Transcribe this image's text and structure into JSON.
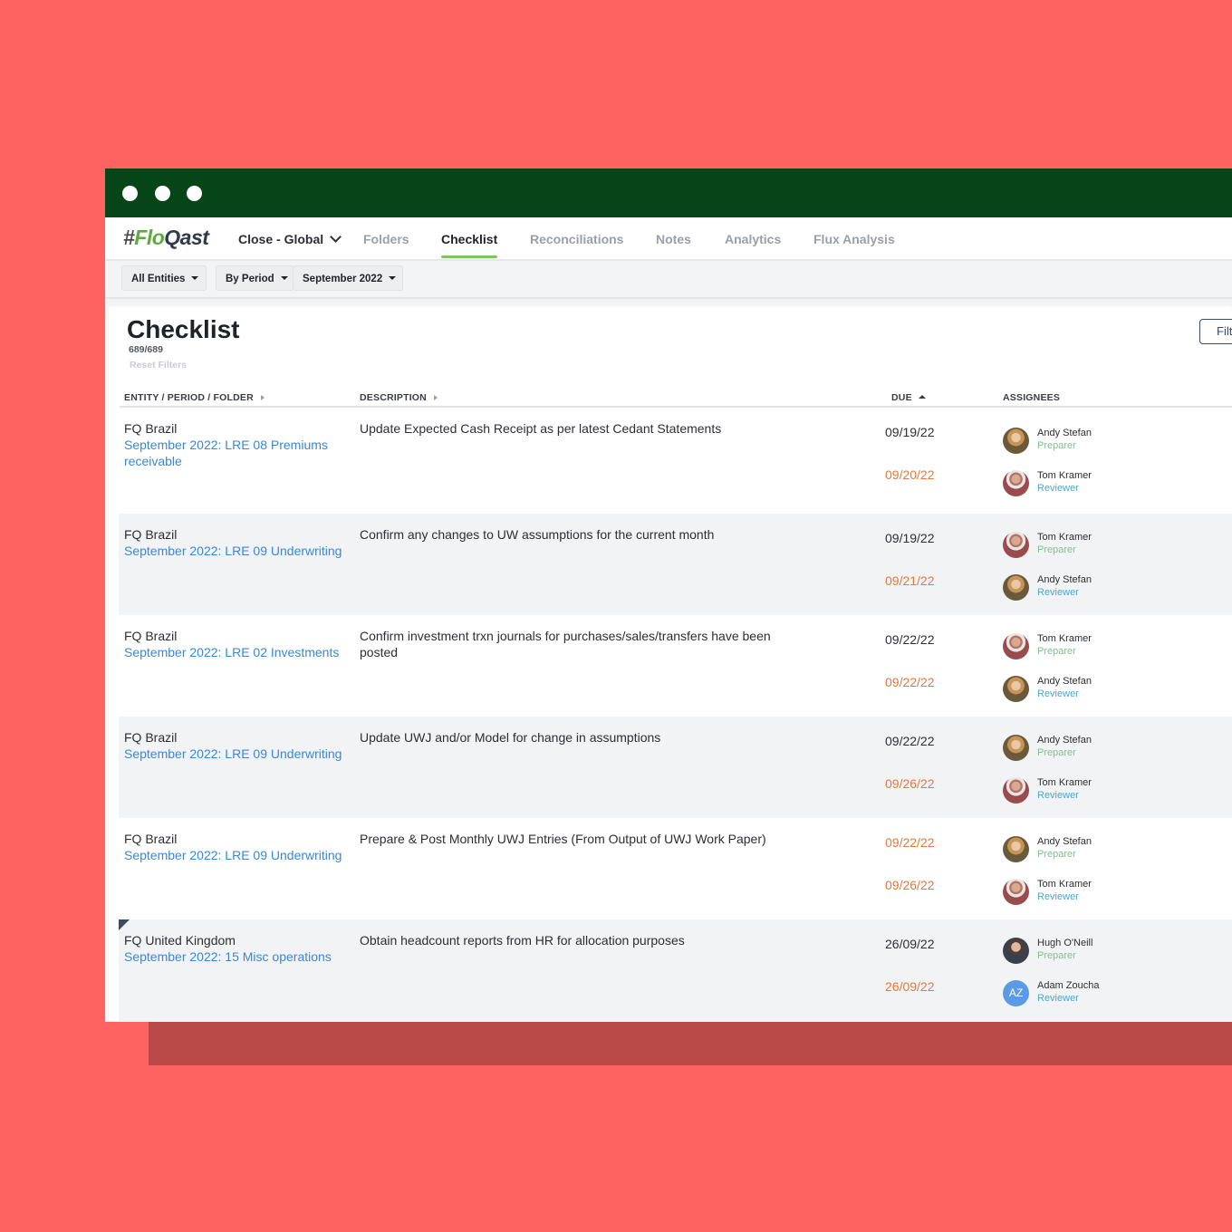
{
  "nav": {
    "logo_hash": "#",
    "logo_flo": "Flo",
    "logo_qast": "Qast",
    "workspace": "Close - Global",
    "tabs": [
      "Folders",
      "Checklist",
      "Reconciliations",
      "Notes",
      "Analytics",
      "Flux Analysis"
    ]
  },
  "filters": {
    "entities": "All Entities",
    "period_mode": "By Period",
    "period": "September 2022"
  },
  "page": {
    "title": "Checklist",
    "count": "689/689",
    "reset": "Reset Filters",
    "filter_btn": "Filt"
  },
  "table": {
    "headers": {
      "entity": "ENTITY / PERIOD / FOLDER",
      "description": "DESCRIPTION",
      "due": "DUE",
      "assignees": "ASSIGNEES"
    },
    "rows": [
      {
        "entity": "FQ Brazil",
        "folder": "September 2022: LRE 08 Premiums receivable",
        "description": "Update Expected Cash Receipt as per latest Cedant Statements",
        "due1": "09/19/22",
        "due2": "09/20/22",
        "a1": {
          "name": "Andy Stefan",
          "role": "Preparer"
        },
        "a2": {
          "name": "Tom Kramer",
          "role": "Reviewer"
        }
      },
      {
        "entity": "FQ Brazil",
        "folder": "September 2022: LRE 09 Underwriting",
        "description": "Confirm any changes to UW assumptions for the current month",
        "due1": "09/19/22",
        "due2": "09/21/22",
        "a1": {
          "name": "Tom Kramer",
          "role": "Preparer"
        },
        "a2": {
          "name": "Andy Stefan",
          "role": "Reviewer"
        }
      },
      {
        "entity": "FQ Brazil",
        "folder": "September 2022: LRE 02 Investments",
        "description": "Confirm investment trxn journals for purchases/sales/transfers have been posted",
        "due1": "09/22/22",
        "due2": "09/22/22",
        "a1": {
          "name": "Tom Kramer",
          "role": "Preparer"
        },
        "a2": {
          "name": "Andy Stefan",
          "role": "Reviewer"
        }
      },
      {
        "entity": "FQ Brazil",
        "folder": "September 2022: LRE 09 Underwriting",
        "description": "Update UWJ and/or Model for change in assumptions",
        "due1": "09/22/22",
        "due2": "09/26/22",
        "a1": {
          "name": "Andy Stefan",
          "role": "Preparer"
        },
        "a2": {
          "name": "Tom Kramer",
          "role": "Reviewer"
        }
      },
      {
        "entity": "FQ Brazil",
        "folder": "September 2022: LRE 09 Underwriting",
        "description": "Prepare & Post Monthly UWJ Entries (From Output of UWJ Work Paper)",
        "due1": "09/22/22",
        "due2": "09/26/22",
        "a1": {
          "name": "Andy Stefan",
          "role": "Preparer"
        },
        "a2": {
          "name": "Tom Kramer",
          "role": "Reviewer"
        }
      },
      {
        "entity": "FQ United Kingdom",
        "folder": "September 2022: 15 Misc operations",
        "description": "Obtain headcount reports from HR for allocation purposes",
        "due1": "26/09/22",
        "due2": "26/09/22",
        "a1": {
          "name": "Hugh O'Neill",
          "role": "Preparer"
        },
        "a2": {
          "name": "Adam Zoucha",
          "role": "Reviewer",
          "initials": "AZ"
        }
      }
    ]
  },
  "colors": {
    "background": "#ff6361",
    "titlebar": "#064517",
    "link": "#3b87d3",
    "due_late": "#e07a3c",
    "active_tab_underline": "#7fc35a"
  }
}
